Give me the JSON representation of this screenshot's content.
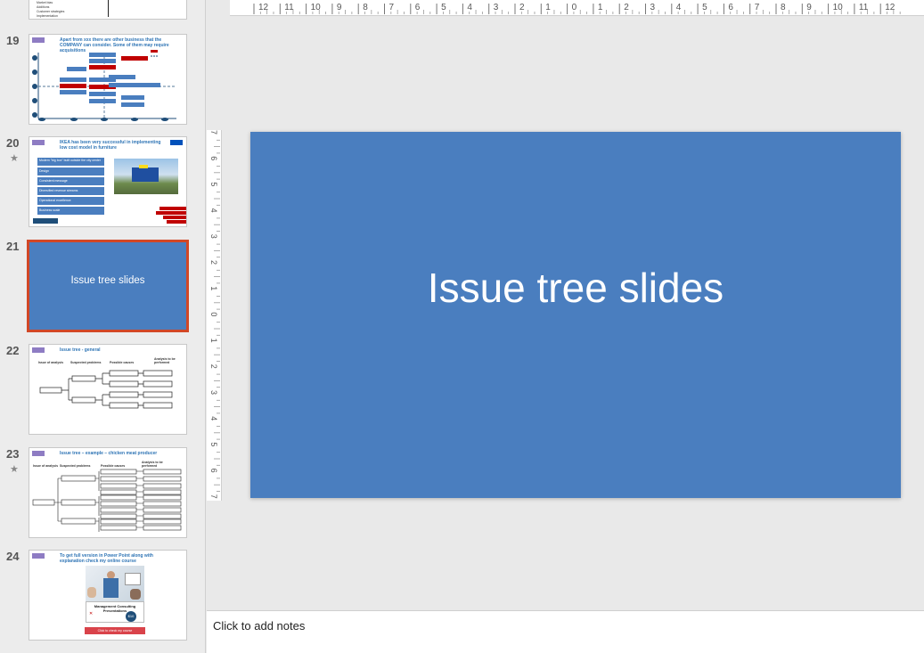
{
  "thumbnails": {
    "prev_partial_lines": [
      "Market bias",
      "Additions",
      "Customer strategies",
      "Implementation"
    ],
    "s19": {
      "number": "19",
      "title": "Apart from xxx there are other business that the COMPANY can consider. Some of them may require acquisitions"
    },
    "s20": {
      "number": "20",
      "title": "IKEA has been very successful in implementing low cost model in furniture",
      "items": [
        "Modern \"big box\" built outside the city center",
        "Design",
        "Consistent message",
        "Diversified revenue streams",
        "Operational excellence",
        "Business scale"
      ]
    },
    "s21": {
      "number": "21",
      "title": "Issue tree slides"
    },
    "s22": {
      "number": "22",
      "title": "Issue tree - general",
      "cols": [
        "Issue of analysis",
        "Suspected problems",
        "Possible causes",
        "Analysis to be performed"
      ]
    },
    "s23": {
      "number": "23",
      "title": "Issue tree – example – chicken meat producer",
      "cols": [
        "Issue of analysis",
        "Suspected problems",
        "Possible causes",
        "Analysis to be performed"
      ]
    },
    "s24": {
      "number": "24",
      "title": "To get full version in Power Point along with explanation check my online course",
      "course_title": "Management Consulting Presentations",
      "price": "$10",
      "button": "Click to check my course"
    }
  },
  "ruler": {
    "top_labels": [
      "12",
      "11",
      "10",
      "9",
      "8",
      "7",
      "6",
      "5",
      "4",
      "3",
      "2",
      "1",
      "0",
      "1",
      "2",
      "3",
      "4",
      "5",
      "6",
      "7",
      "8",
      "9",
      "10",
      "11",
      "12"
    ],
    "left_labels": [
      "7",
      "6",
      "5",
      "4",
      "3",
      "2",
      "1",
      "0",
      "1",
      "2",
      "3",
      "4",
      "5",
      "6",
      "7"
    ]
  },
  "slide": {
    "title": "Issue tree slides",
    "background": "#4a7ebf"
  },
  "notes": {
    "placeholder": "Click to add notes"
  },
  "colors": {
    "selection": "#d24726",
    "accent_blue": "#4a7ebf",
    "accent_red": "#c00000"
  }
}
